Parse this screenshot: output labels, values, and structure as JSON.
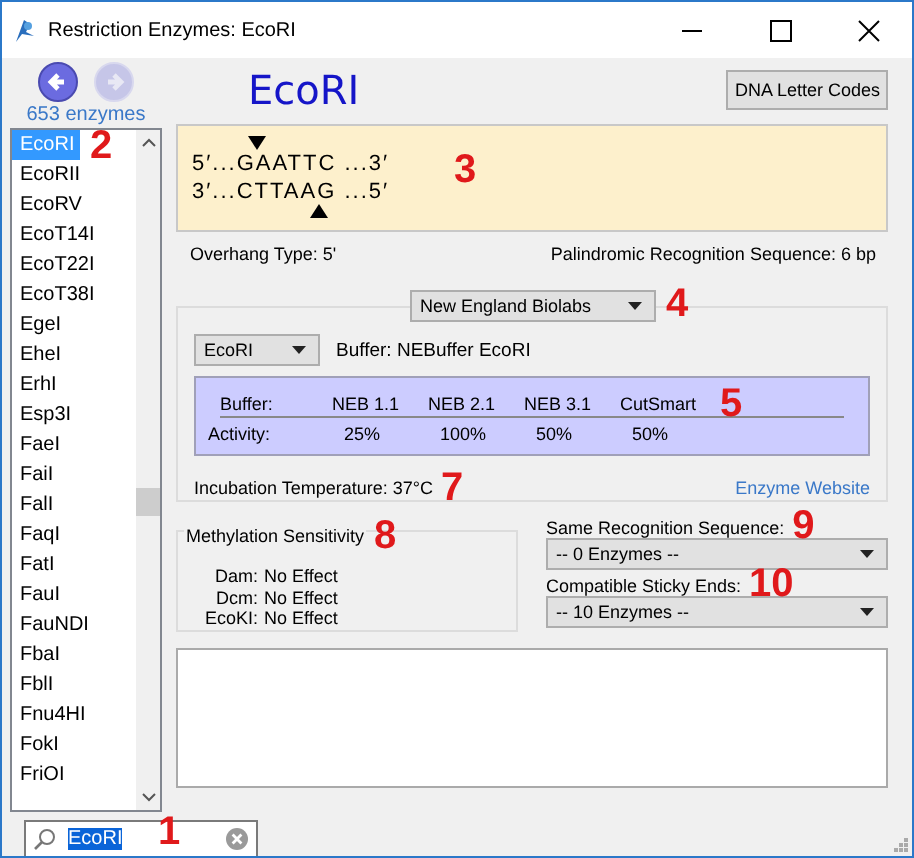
{
  "window": {
    "title": "Restriction Enzymes: EcoRI"
  },
  "navigation": {
    "buttons": [
      {
        "kind": "back",
        "disabled": false
      },
      {
        "kind": "forward",
        "disabled": true
      }
    ],
    "count": "653 enzymes"
  },
  "enzyme_list": {
    "callout": "2",
    "items": [
      {
        "label": "EcoRI",
        "selected": true
      },
      {
        "label": "EcoRII",
        "selected": false
      },
      {
        "label": "EcoRV",
        "selected": false
      },
      {
        "label": "EcoT14I",
        "selected": false
      },
      {
        "label": "EcoT22I",
        "selected": false
      },
      {
        "label": "EcoT38I",
        "selected": false
      },
      {
        "label": "EgeI",
        "selected": false
      },
      {
        "label": "EheI",
        "selected": false
      },
      {
        "label": "ErhI",
        "selected": false
      },
      {
        "label": "Esp3I",
        "selected": false
      },
      {
        "label": "FaeI",
        "selected": false
      },
      {
        "label": "FaiI",
        "selected": false
      },
      {
        "label": "FalI",
        "selected": false
      },
      {
        "label": "FaqI",
        "selected": false
      },
      {
        "label": "FatI",
        "selected": false
      },
      {
        "label": "FauI",
        "selected": false
      },
      {
        "label": "FauNDI",
        "selected": false
      },
      {
        "label": "FbaI",
        "selected": false
      },
      {
        "label": "FblI",
        "selected": false
      },
      {
        "label": "Fnu4HI",
        "selected": false
      },
      {
        "label": "FokI",
        "selected": false
      },
      {
        "label": "FriOI",
        "selected": false
      }
    ]
  },
  "search": {
    "value": "EcoRI",
    "callout": "1"
  },
  "header": {
    "title": "EcoRI",
    "button": "DNA Letter Codes"
  },
  "sequence": {
    "callout": "3",
    "top": {
      "left": "5′...",
      "before_cut": "G",
      "after_cut": "AATTC",
      "right": "...3′"
    },
    "bottom": {
      "left": "3′...",
      "before_cut": "CTTAA",
      "after_cut": "G",
      "right": "...5′"
    }
  },
  "overhang": {
    "label": "Overhang Type:",
    "value": "5'"
  },
  "palindromic": {
    "label": "Palindromic Recognition Sequence:",
    "value": "6 bp"
  },
  "supplier": {
    "value": "New England Biolabs",
    "callout": "4"
  },
  "enzyme_select": {
    "value": "EcoRI"
  },
  "buffer": {
    "label": "Buffer:",
    "value": "NEBuffer EcoRI"
  },
  "buffer_table": {
    "callout": "5",
    "row_labels": [
      "Buffer:",
      "Activity:"
    ],
    "buffers": [
      "NEB 1.1",
      "NEB 2.1",
      "NEB 3.1",
      "CutSmart"
    ],
    "activity": [
      "25%",
      "100%",
      "50%",
      "50%"
    ]
  },
  "incubation": {
    "label": "Incubation Temperature:",
    "value": "37°C",
    "callout": "7"
  },
  "website_link": "Enzyme Website",
  "methylation": {
    "title": "Methylation Sensitivity",
    "callout": "8",
    "rows": [
      {
        "type": "Dam:",
        "effect": "No Effect"
      },
      {
        "type": "Dcm:",
        "effect": "No Effect"
      },
      {
        "type": "EcoKI:",
        "effect": "No Effect"
      }
    ]
  },
  "same_recognition": {
    "label": "Same Recognition Sequence:",
    "value": "-- 0 Enzymes --",
    "callout": "9"
  },
  "sticky_ends": {
    "label": "Compatible Sticky Ends:",
    "value": "-- 10 Enzymes --",
    "callout": "10"
  }
}
